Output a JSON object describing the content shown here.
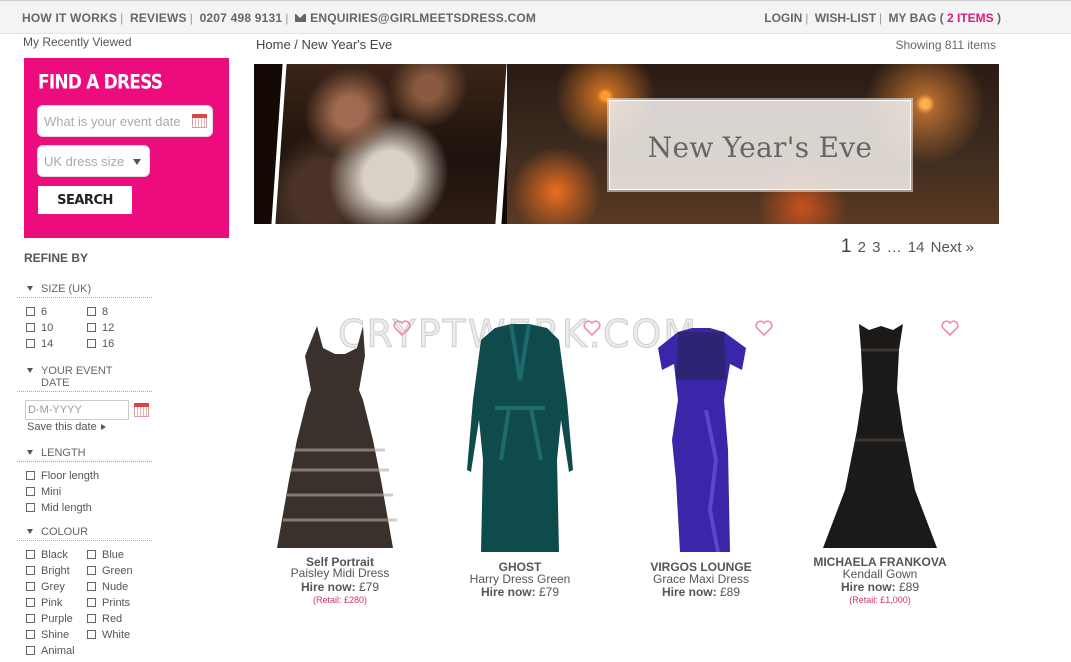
{
  "topbar": {
    "how_it_works": "HOW IT WORKS",
    "reviews": "REVIEWS",
    "phone": "0207 498 9131",
    "email": "ENQUIRIES@GIRLMEETSDRESS.COM",
    "login": "LOGIN",
    "wishlist": "WISH-LIST",
    "bag_prefix": "MY BAG (",
    "bag_count": "2 ITEMS",
    "bag_suffix": ")"
  },
  "recently_viewed": "My Recently Viewed",
  "finder": {
    "title": "FIND A DRESS",
    "date_placeholder": "What is your event date",
    "size_label": "UK dress size",
    "search_label": "SEARCH"
  },
  "refine": {
    "title": "REFINE BY",
    "size": {
      "heading": "SIZE (UK)",
      "options": [
        "6",
        "8",
        "10",
        "12",
        "14",
        "16"
      ]
    },
    "event": {
      "heading_line1": "YOUR EVENT",
      "heading_line2": "DATE",
      "placeholder": "D-M-YYYY",
      "save_label": "Save this date"
    },
    "length": {
      "heading": "LENGTH",
      "options": [
        "Floor length",
        "Mini",
        "Mid length"
      ]
    },
    "colour": {
      "heading": "COLOUR",
      "options": [
        "Black",
        "Blue",
        "Bright",
        "Green",
        "Grey",
        "Nude",
        "Pink",
        "Prints",
        "Purple",
        "Red",
        "Shine",
        "White",
        "Animal"
      ]
    }
  },
  "breadcrumb": {
    "home": "Home",
    "sep": " / ",
    "current": "New Year's Eve"
  },
  "showing": "Showing 811 items",
  "banner": {
    "title": "New Year's Eve"
  },
  "pager": {
    "current": "1",
    "p2": "2",
    "p3": "3",
    "ellipsis": "…",
    "last": "14",
    "next": "Next »"
  },
  "watermark": "CRYPTWERK.COM",
  "products": [
    {
      "brand": "Self Portrait",
      "name": "Paisley Midi Dress",
      "hire_label": "Hire now:",
      "price": "£79",
      "retail": "(Retail: £280)",
      "color": "#3a302c",
      "accent": "#b9aaa0"
    },
    {
      "brand": "GHOST",
      "name": "Harry Dress Green",
      "hire_label": "Hire now:",
      "price": "£79",
      "retail": "",
      "color": "#0f4a4c",
      "accent": "#1d6b6c"
    },
    {
      "brand": "VIRGOS LOUNGE",
      "name": "Grace Maxi Dress",
      "hire_label": "Hire now:",
      "price": "£89",
      "retail": "",
      "color": "#3a26a8",
      "accent": "#5a47c9"
    },
    {
      "brand": "MICHAELA FRANKOVA",
      "name": "Kendall Gown",
      "hire_label": "Hire now:",
      "price": "£89",
      "retail": "(Retail: £1,000)",
      "color": "#1c1a18",
      "accent": "#3a3630"
    }
  ],
  "colors": {
    "brand_pink": "#ec0c7e",
    "heart_pink": "#f08ab5",
    "retail_pink": "#d0306f"
  }
}
